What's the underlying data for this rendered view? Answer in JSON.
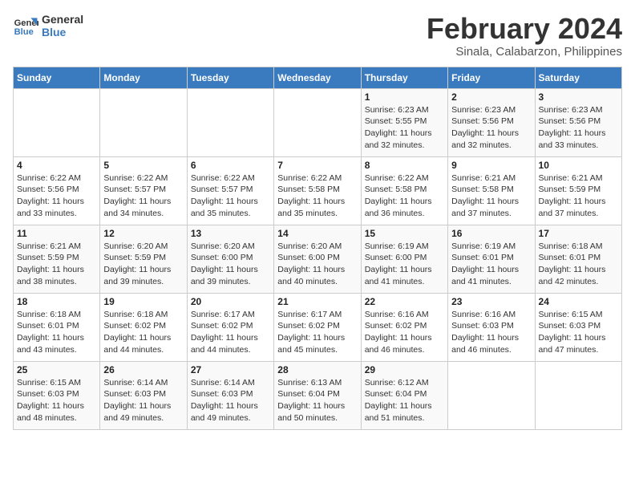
{
  "logo": {
    "line1": "General",
    "line2": "Blue"
  },
  "title": "February 2024",
  "subtitle": "Sinala, Calabarzon, Philippines",
  "weekdays": [
    "Sunday",
    "Monday",
    "Tuesday",
    "Wednesday",
    "Thursday",
    "Friday",
    "Saturday"
  ],
  "weeks": [
    [
      {
        "day": "",
        "sunrise": "",
        "sunset": "",
        "daylight": ""
      },
      {
        "day": "",
        "sunrise": "",
        "sunset": "",
        "daylight": ""
      },
      {
        "day": "",
        "sunrise": "",
        "sunset": "",
        "daylight": ""
      },
      {
        "day": "",
        "sunrise": "",
        "sunset": "",
        "daylight": ""
      },
      {
        "day": "1",
        "sunrise": "Sunrise: 6:23 AM",
        "sunset": "Sunset: 5:55 PM",
        "daylight": "Daylight: 11 hours and 32 minutes."
      },
      {
        "day": "2",
        "sunrise": "Sunrise: 6:23 AM",
        "sunset": "Sunset: 5:56 PM",
        "daylight": "Daylight: 11 hours and 32 minutes."
      },
      {
        "day": "3",
        "sunrise": "Sunrise: 6:23 AM",
        "sunset": "Sunset: 5:56 PM",
        "daylight": "Daylight: 11 hours and 33 minutes."
      }
    ],
    [
      {
        "day": "4",
        "sunrise": "Sunrise: 6:22 AM",
        "sunset": "Sunset: 5:56 PM",
        "daylight": "Daylight: 11 hours and 33 minutes."
      },
      {
        "day": "5",
        "sunrise": "Sunrise: 6:22 AM",
        "sunset": "Sunset: 5:57 PM",
        "daylight": "Daylight: 11 hours and 34 minutes."
      },
      {
        "day": "6",
        "sunrise": "Sunrise: 6:22 AM",
        "sunset": "Sunset: 5:57 PM",
        "daylight": "Daylight: 11 hours and 35 minutes."
      },
      {
        "day": "7",
        "sunrise": "Sunrise: 6:22 AM",
        "sunset": "Sunset: 5:58 PM",
        "daylight": "Daylight: 11 hours and 35 minutes."
      },
      {
        "day": "8",
        "sunrise": "Sunrise: 6:22 AM",
        "sunset": "Sunset: 5:58 PM",
        "daylight": "Daylight: 11 hours and 36 minutes."
      },
      {
        "day": "9",
        "sunrise": "Sunrise: 6:21 AM",
        "sunset": "Sunset: 5:58 PM",
        "daylight": "Daylight: 11 hours and 37 minutes."
      },
      {
        "day": "10",
        "sunrise": "Sunrise: 6:21 AM",
        "sunset": "Sunset: 5:59 PM",
        "daylight": "Daylight: 11 hours and 37 minutes."
      }
    ],
    [
      {
        "day": "11",
        "sunrise": "Sunrise: 6:21 AM",
        "sunset": "Sunset: 5:59 PM",
        "daylight": "Daylight: 11 hours and 38 minutes."
      },
      {
        "day": "12",
        "sunrise": "Sunrise: 6:20 AM",
        "sunset": "Sunset: 5:59 PM",
        "daylight": "Daylight: 11 hours and 39 minutes."
      },
      {
        "day": "13",
        "sunrise": "Sunrise: 6:20 AM",
        "sunset": "Sunset: 6:00 PM",
        "daylight": "Daylight: 11 hours and 39 minutes."
      },
      {
        "day": "14",
        "sunrise": "Sunrise: 6:20 AM",
        "sunset": "Sunset: 6:00 PM",
        "daylight": "Daylight: 11 hours and 40 minutes."
      },
      {
        "day": "15",
        "sunrise": "Sunrise: 6:19 AM",
        "sunset": "Sunset: 6:00 PM",
        "daylight": "Daylight: 11 hours and 41 minutes."
      },
      {
        "day": "16",
        "sunrise": "Sunrise: 6:19 AM",
        "sunset": "Sunset: 6:01 PM",
        "daylight": "Daylight: 11 hours and 41 minutes."
      },
      {
        "day": "17",
        "sunrise": "Sunrise: 6:18 AM",
        "sunset": "Sunset: 6:01 PM",
        "daylight": "Daylight: 11 hours and 42 minutes."
      }
    ],
    [
      {
        "day": "18",
        "sunrise": "Sunrise: 6:18 AM",
        "sunset": "Sunset: 6:01 PM",
        "daylight": "Daylight: 11 hours and 43 minutes."
      },
      {
        "day": "19",
        "sunrise": "Sunrise: 6:18 AM",
        "sunset": "Sunset: 6:02 PM",
        "daylight": "Daylight: 11 hours and 44 minutes."
      },
      {
        "day": "20",
        "sunrise": "Sunrise: 6:17 AM",
        "sunset": "Sunset: 6:02 PM",
        "daylight": "Daylight: 11 hours and 44 minutes."
      },
      {
        "day": "21",
        "sunrise": "Sunrise: 6:17 AM",
        "sunset": "Sunset: 6:02 PM",
        "daylight": "Daylight: 11 hours and 45 minutes."
      },
      {
        "day": "22",
        "sunrise": "Sunrise: 6:16 AM",
        "sunset": "Sunset: 6:02 PM",
        "daylight": "Daylight: 11 hours and 46 minutes."
      },
      {
        "day": "23",
        "sunrise": "Sunrise: 6:16 AM",
        "sunset": "Sunset: 6:03 PM",
        "daylight": "Daylight: 11 hours and 46 minutes."
      },
      {
        "day": "24",
        "sunrise": "Sunrise: 6:15 AM",
        "sunset": "Sunset: 6:03 PM",
        "daylight": "Daylight: 11 hours and 47 minutes."
      }
    ],
    [
      {
        "day": "25",
        "sunrise": "Sunrise: 6:15 AM",
        "sunset": "Sunset: 6:03 PM",
        "daylight": "Daylight: 11 hours and 48 minutes."
      },
      {
        "day": "26",
        "sunrise": "Sunrise: 6:14 AM",
        "sunset": "Sunset: 6:03 PM",
        "daylight": "Daylight: 11 hours and 49 minutes."
      },
      {
        "day": "27",
        "sunrise": "Sunrise: 6:14 AM",
        "sunset": "Sunset: 6:03 PM",
        "daylight": "Daylight: 11 hours and 49 minutes."
      },
      {
        "day": "28",
        "sunrise": "Sunrise: 6:13 AM",
        "sunset": "Sunset: 6:04 PM",
        "daylight": "Daylight: 11 hours and 50 minutes."
      },
      {
        "day": "29",
        "sunrise": "Sunrise: 6:12 AM",
        "sunset": "Sunset: 6:04 PM",
        "daylight": "Daylight: 11 hours and 51 minutes."
      },
      {
        "day": "",
        "sunrise": "",
        "sunset": "",
        "daylight": ""
      },
      {
        "day": "",
        "sunrise": "",
        "sunset": "",
        "daylight": ""
      }
    ]
  ]
}
